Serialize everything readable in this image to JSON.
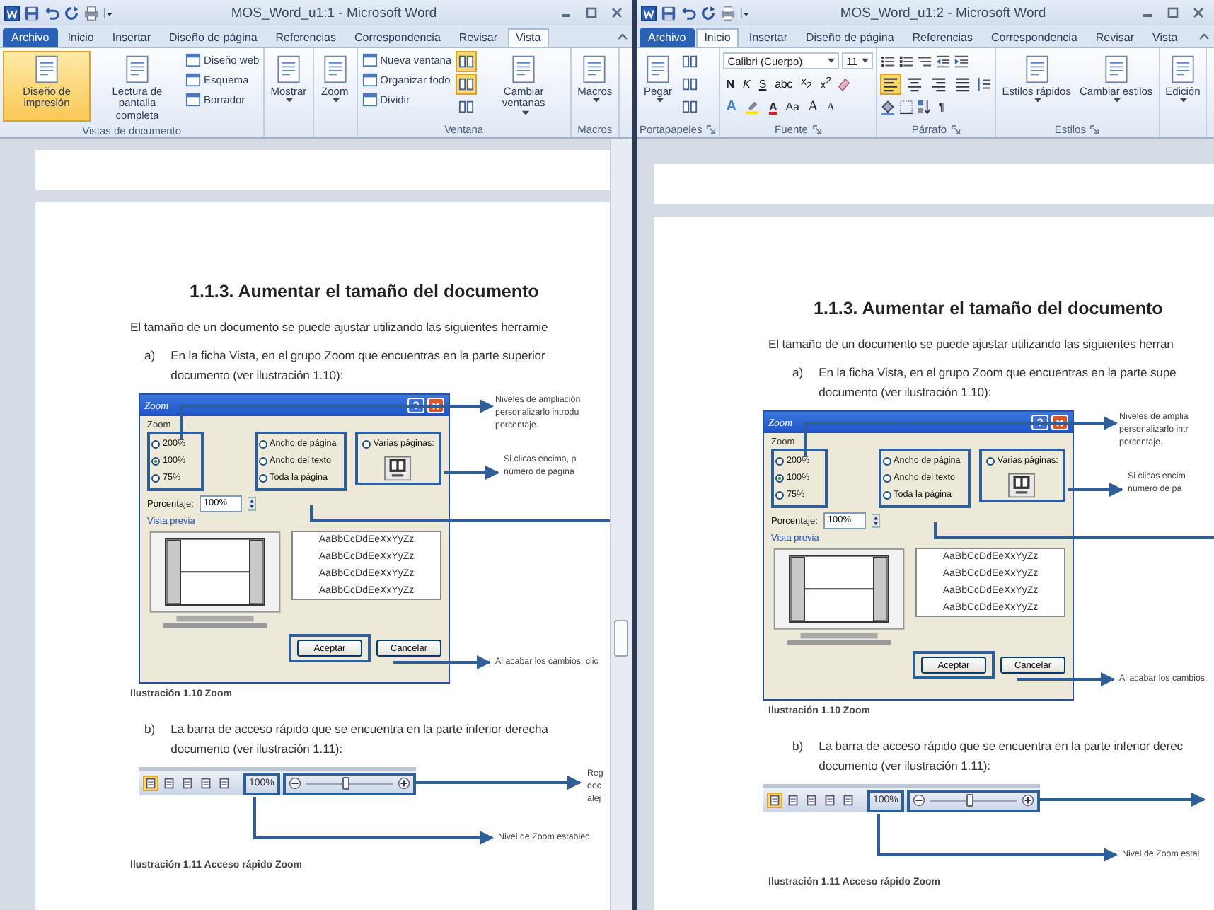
{
  "windows": [
    {
      "title": "MOS_Word_u1:1 - Microsoft Word",
      "tabs": [
        {
          "label": "Archivo",
          "kind": "file",
          "selected": false
        },
        {
          "label": "Inicio",
          "kind": "tab",
          "selected": false
        },
        {
          "label": "Insertar",
          "kind": "tab",
          "selected": false
        },
        {
          "label": "Diseño de página",
          "kind": "tab",
          "selected": false
        },
        {
          "label": "Referencias",
          "kind": "tab",
          "selected": false
        },
        {
          "label": "Correspondencia",
          "kind": "tab",
          "selected": false
        },
        {
          "label": "Revisar",
          "kind": "tab",
          "selected": false
        },
        {
          "label": "Vista",
          "kind": "tab",
          "selected": true
        }
      ],
      "ribbon": {
        "groups": [
          {
            "label": "Vistas de documento",
            "launcher": false,
            "kind": "items",
            "items": [
              {
                "kind": "large",
                "label": "Diseño de impresión",
                "selected": true
              },
              {
                "kind": "large",
                "label": "Lectura de pantalla completa",
                "selected": false
              },
              {
                "kind": "stack",
                "items": [
                  {
                    "label": "Diseño web"
                  },
                  {
                    "label": "Esquema"
                  },
                  {
                    "label": "Borrador"
                  }
                ]
              }
            ]
          },
          {
            "launcher": false,
            "kind": "items",
            "items": [
              {
                "kind": "large",
                "label": "Mostrar",
                "dropdown": true
              }
            ]
          },
          {
            "launcher": false,
            "kind": "items",
            "items": [
              {
                "kind": "large",
                "label": "Zoom",
                "dropdown": true
              }
            ]
          },
          {
            "label": "Ventana",
            "launcher": false,
            "kind": "items",
            "items": [
              {
                "kind": "stack",
                "items": [
                  {
                    "label": "Nueva ventana"
                  },
                  {
                    "label": "Organizar todo"
                  },
                  {
                    "label": "Dividir"
                  }
                ]
              },
              {
                "kind": "iconstack",
                "buttons": [
                  {
                    "selected": true
                  },
                  {
                    "selected": true
                  },
                  {
                    "selected": false
                  }
                ]
              },
              {
                "kind": "large",
                "label": "Cambiar ventanas",
                "dropdown": true
              }
            ]
          },
          {
            "label": "Macros",
            "launcher": false,
            "kind": "items",
            "items": [
              {
                "kind": "large",
                "label": "Macros",
                "dropdown": true
              }
            ]
          }
        ]
      },
      "document": {
        "blocks": [
          {
            "kind": "heading",
            "text": "1.1.3. Aumentar el tamaño del documento"
          },
          {
            "kind": "paragraph",
            "text": "El tamaño de un documento se puede ajustar utilizando las siguientes herramie"
          },
          {
            "kind": "list_item",
            "marker": "a)",
            "lines": [
              "En la ficha Vista, en el grupo Zoom que encuentras en la parte superior",
              "documento (ver ilustración 1.10):"
            ]
          },
          {
            "kind": "zoom_dialog",
            "title": "Zoom",
            "help": "?",
            "group_label": "Zoom",
            "zoom_levels": [
              {
                "label": "200%",
                "selected": false
              },
              {
                "label": "100%",
                "selected": true
              },
              {
                "label": "75%",
                "selected": false
              }
            ],
            "fit_options": [
              {
                "label": "Ancho de página",
                "selected": false
              },
              {
                "label": "Ancho del texto",
                "selected": false
              },
              {
                "label": "Toda la página",
                "selected": false
              }
            ],
            "many_pages": {
              "label": "Varias páginas:",
              "selected": false
            },
            "percent_label": "Porcentaje:",
            "percent": "100%",
            "preview_label": "Vista previa",
            "samples": [
              "AaBbCcDdEeXxYyZz",
              "AaBbCcDdEeXxYyZz",
              "AaBbCcDdEeXxYyZz",
              "AaBbCcDdEeXxYyZz"
            ],
            "buttons": [
              {
                "label": "Aceptar",
                "kind": "default"
              },
              {
                "label": "Cancelar",
                "kind": "normal"
              }
            ],
            "callouts": [
              {
                "kind": "levels",
                "lines": [
                  "Niveles de ampliación",
                  "personalizarlo introdu",
                  "porcentaje."
                ]
              },
              {
                "kind": "pages",
                "lines": [
                  "Si clicas encima, p",
                  "número de página"
                ]
              },
              {
                "kind": "accept",
                "lines": [
                  "Al acabar los cambios, clic"
                ]
              }
            ]
          },
          {
            "kind": "caption",
            "text": "Ilustración 1.10 Zoom"
          },
          {
            "kind": "list_item",
            "marker": "b)",
            "lines": [
              "La barra de acceso rápido que se encuentra en la parte inferior derecha",
              "documento (ver ilustración 1.11):"
            ]
          },
          {
            "kind": "zoom_bar",
            "views": [
              {
                "selected": true
              },
              {
                "selected": false
              },
              {
                "selected": false
              },
              {
                "selected": false
              },
              {
                "selected": false
              }
            ],
            "percent": "100%",
            "level": 0.45,
            "callouts": [
              {
                "kind": "slider",
                "lines": [
                  "Reg",
                  "doc",
                  "alej"
                ]
              },
              {
                "kind": "percent",
                "lines": [
                  "Nivel de Zoom establec"
                ]
              }
            ]
          },
          {
            "kind": "caption",
            "text": "Ilustración 1.11 Acceso rápido Zoom"
          }
        ]
      }
    },
    {
      "title": "MOS_Word_u1:2 - Microsoft Word",
      "tabs": [
        {
          "label": "Archivo",
          "kind": "file",
          "selected": false
        },
        {
          "label": "Inicio",
          "kind": "tab",
          "selected": true
        },
        {
          "label": "Insertar",
          "kind": "tab",
          "selected": false
        },
        {
          "label": "Diseño de página",
          "kind": "tab",
          "selected": false
        },
        {
          "label": "Referencias",
          "kind": "tab",
          "selected": false
        },
        {
          "label": "Correspondencia",
          "kind": "tab",
          "selected": false
        },
        {
          "label": "Revisar",
          "kind": "tab",
          "selected": false
        },
        {
          "label": "Vista",
          "kind": "tab",
          "selected": false
        }
      ],
      "ribbon": {
        "groups": [
          {
            "label": "Portapapeles",
            "launcher": true,
            "kind": "items",
            "items": [
              {
                "kind": "large",
                "label": "Pegar",
                "dropdown": true
              },
              {
                "kind": "iconstack",
                "buttons": [
                  {
                    "selected": false
                  },
                  {
                    "selected": false
                  },
                  {
                    "selected": false
                  }
                ]
              }
            ]
          },
          {
            "label": "Fuente",
            "launcher": true,
            "kind": "font",
            "font_name": "Calibri (Cuerpo)",
            "font_size": "11",
            "format_buttons": [
              {
                "kind": "bold",
                "label": "N"
              },
              {
                "kind": "italic",
                "label": "K"
              },
              {
                "kind": "underline",
                "label": "S"
              },
              {
                "kind": "strike",
                "label": "abc"
              },
              {
                "kind": "sub",
                "label": "x$_{2}$"
              },
              {
                "kind": "sup",
                "label": "x$^{2}$"
              }
            ],
            "effect_buttons": [
              {
                "kind": "effects",
                "label": "A"
              },
              {
                "kind": "highlight"
              },
              {
                "kind": "color",
                "label": "A"
              },
              {
                "kind": "case",
                "label": "Aa"
              },
              {
                "kind": "grow",
                "label": "A"
              },
              {
                "kind": "shrink",
                "label": "A"
              }
            ]
          },
          {
            "label": "Párrafo",
            "launcher": true,
            "kind": "paragraph",
            "align": [
              {
                "selected": true
              },
              {
                "selected": false
              },
              {
                "selected": false
              },
              {
                "selected": false
              }
            ],
            "pilcrow": "¶"
          },
          {
            "label": "Estilos",
            "launcher": true,
            "kind": "items",
            "items": [
              {
                "kind": "large",
                "label": "Estilos rápidos",
                "dropdown": true
              },
              {
                "kind": "large",
                "label": "Cambiar estilos",
                "dropdown": true
              }
            ]
          },
          {
            "launcher": false,
            "kind": "items",
            "items": [
              {
                "kind": "large",
                "label": "Edición",
                "dropdown": true
              }
            ]
          }
        ]
      },
      "document": {
        "blocks": [
          {
            "kind": "heading",
            "text": "1.1.3. Aumentar el tamaño del documento"
          },
          {
            "kind": "paragraph",
            "text": "El tamaño de un documento se puede ajustar utilizando las siguientes herran"
          },
          {
            "kind": "list_item",
            "marker": "a)",
            "lines": [
              "En la ficha Vista, en el grupo Zoom que encuentras en la parte supe",
              "documento (ver ilustración 1.10):"
            ]
          },
          {
            "kind": "zoom_dialog",
            "title": "Zoom",
            "help": "?",
            "group_label": "Zoom",
            "zoom_levels": [
              {
                "label": "200%",
                "selected": false
              },
              {
                "label": "100%",
                "selected": true
              },
              {
                "label": "75%",
                "selected": false
              }
            ],
            "fit_options": [
              {
                "label": "Ancho de página",
                "selected": false
              },
              {
                "label": "Ancho del texto",
                "selected": false
              },
              {
                "label": "Toda la página",
                "selected": false
              }
            ],
            "many_pages": {
              "label": "Varias páginas:",
              "selected": false
            },
            "percent_label": "Porcentaje:",
            "percent": "100%",
            "preview_label": "Vista previa",
            "samples": [
              "AaBbCcDdEeXxYyZz",
              "AaBbCcDdEeXxYyZz",
              "AaBbCcDdEeXxYyZz",
              "AaBbCcDdEeXxYyZz"
            ],
            "buttons": [
              {
                "label": "Aceptar",
                "kind": "default"
              },
              {
                "label": "Cancelar",
                "kind": "normal"
              }
            ],
            "callouts": [
              {
                "kind": "levels",
                "lines": [
                  "Niveles de amplia",
                  "personalizarlo intr",
                  "porcentaje."
                ]
              },
              {
                "kind": "pages",
                "lines": [
                  "Si clicas encim",
                  "número de pá"
                ]
              },
              {
                "kind": "accept",
                "lines": [
                  "Al acabar los cambios,"
                ]
              }
            ]
          },
          {
            "kind": "caption",
            "text": "Ilustración 1.10 Zoom"
          },
          {
            "kind": "list_item",
            "marker": "b)",
            "lines": [
              "La barra de acceso rápido que se encuentra en la parte inferior derec",
              "documento (ver ilustración 1.11):"
            ]
          },
          {
            "kind": "zoom_bar",
            "views": [
              {
                "selected": true
              },
              {
                "selected": false
              },
              {
                "selected": false
              },
              {
                "selected": false
              },
              {
                "selected": false
              }
            ],
            "percent": "100%",
            "level": 0.45,
            "callouts": [
              {
                "kind": "percent",
                "lines": [
                  "Nivel de Zoom estal"
                ]
              }
            ]
          },
          {
            "kind": "caption",
            "text": "Ilustración 1.11 Acceso rápido Zoom"
          }
        ]
      }
    }
  ]
}
